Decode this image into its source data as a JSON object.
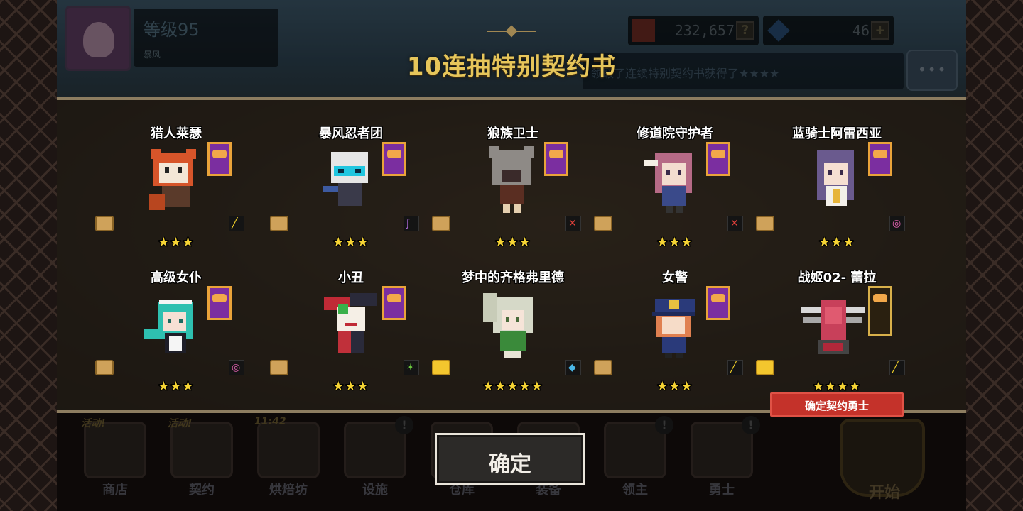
{
  "title": "10连抽特别契约书",
  "player": {
    "level": "等级95",
    "name": "暴风"
  },
  "resources": {
    "gold": "232,657",
    "gems": "46"
  },
  "ticker": "领取了连续特别契约书获得了★★★★",
  "heroes": [
    {
      "name": "猎人莱瑟",
      "stars": "★★★",
      "weapon_icon": "staff-icon",
      "weapon_color": "#f2d12a"
    },
    {
      "name": "暴风忍者团",
      "stars": "★★★",
      "weapon_icon": "magic-staff-icon",
      "weapon_color": "#b06ad8"
    },
    {
      "name": "狼族卫士",
      "stars": "★★★",
      "weapon_icon": "crossed-swords-icon",
      "weapon_color": "#e0403a"
    },
    {
      "name": "修道院守护者",
      "stars": "★★★",
      "weapon_icon": "crossed-swords-icon",
      "weapon_color": "#e0403a"
    },
    {
      "name": "蓝骑士阿雷西亚",
      "stars": "★★★",
      "weapon_icon": "orb-icon",
      "weapon_color": "#e060b0"
    },
    {
      "name": "高级女仆",
      "stars": "★★★",
      "weapon_icon": "orb-icon",
      "weapon_color": "#e060b0"
    },
    {
      "name": "小丑",
      "stars": "★★★",
      "weapon_icon": "shuriken-icon",
      "weapon_color": "#6ac63e"
    },
    {
      "name": "梦中的齐格弗里德",
      "stars": "★★★★★",
      "weapon_icon": "axe-icon",
      "weapon_color": "#4ab6e6"
    },
    {
      "name": "女警",
      "stars": "★★★",
      "weapon_icon": "staff-icon",
      "weapon_color": "#f2d12a"
    },
    {
      "name": "战姬02- 蕾拉",
      "stars": "★★★★",
      "weapon_icon": "staff-icon",
      "weapon_color": "#f2d12a"
    }
  ],
  "confirm_hero_label": "确定契约勇士",
  "confirm_button": "确定",
  "nav": [
    {
      "label": "商店",
      "tag": "活动!"
    },
    {
      "label": "契约",
      "tag": "活动!"
    },
    {
      "label": "烘焙坊",
      "tag": "11:42"
    },
    {
      "label": "设施",
      "tag": ""
    },
    {
      "label": "仓库",
      "tag": ""
    },
    {
      "label": "装备",
      "tag": ""
    },
    {
      "label": "领主",
      "tag": ""
    },
    {
      "label": "勇士",
      "tag": ""
    }
  ],
  "start_label": "开始"
}
